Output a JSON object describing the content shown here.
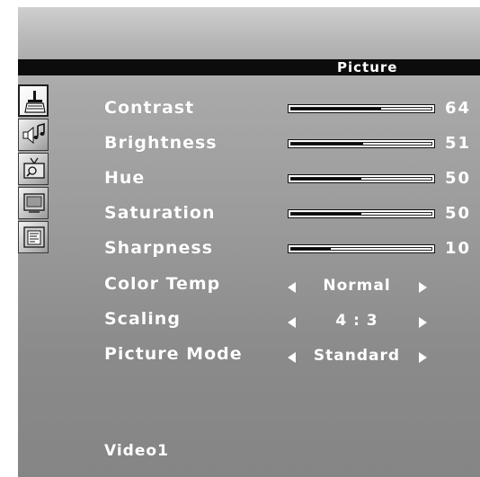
{
  "osd": {
    "menu_title": "Picture",
    "source": "Video1"
  },
  "icons": [
    {
      "name": "picture-brush-icon",
      "active": true
    },
    {
      "name": "audio-speaker-icon",
      "active": false
    },
    {
      "name": "tv-tuning-icon",
      "active": false
    },
    {
      "name": "display-screen-icon",
      "active": false
    },
    {
      "name": "document-setup-icon",
      "active": false
    }
  ],
  "sliders": [
    {
      "label": "Contrast",
      "value": "64",
      "level": 0.64
    },
    {
      "label": "Brightness",
      "value": "51",
      "level": 0.51
    },
    {
      "label": "Hue",
      "value": "50",
      "level": 0.5
    },
    {
      "label": "Saturation",
      "value": "50",
      "level": 0.5
    },
    {
      "label": "Sharpness",
      "value": "10",
      "level": 0.28
    }
  ],
  "options": [
    {
      "label": "Color Temp",
      "value": "Normal"
    },
    {
      "label": "Scaling",
      "value": "4 : 3"
    },
    {
      "label": "Picture Mode",
      "value": "Standard"
    }
  ]
}
